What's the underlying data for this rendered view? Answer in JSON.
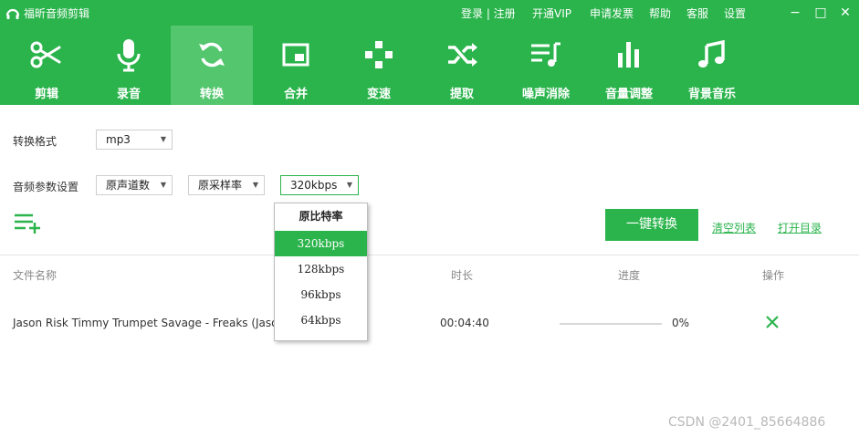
{
  "app": {
    "title": "福昕音频剪辑"
  },
  "top_links": [
    "登录 | 注册",
    "开通VIP",
    "申请发票",
    "帮助",
    "客服",
    "设置"
  ],
  "window_controls": {
    "minimize": "−",
    "maximize": "□",
    "close": "✕"
  },
  "toolbar": {
    "active": "转换",
    "items": [
      {
        "label": "剪辑",
        "icon": "scissors-icon"
      },
      {
        "label": "录音",
        "icon": "microphone-icon"
      },
      {
        "label": "转换",
        "icon": "convert-icon"
      },
      {
        "label": "合并",
        "icon": "merge-icon"
      },
      {
        "label": "变速",
        "icon": "speed-icon"
      },
      {
        "label": "提取",
        "icon": "extract-icon"
      },
      {
        "label": "噪声消除",
        "icon": "noise-reduction-icon"
      },
      {
        "label": "音量调整",
        "icon": "volume-bars-icon"
      },
      {
        "label": "背景音乐",
        "icon": "music-note-icon"
      }
    ]
  },
  "format": {
    "label": "转换格式",
    "value": "mp3"
  },
  "audio_params": {
    "label": "音频参数设置",
    "channel": "原声道数",
    "sample_rate": "原采样率",
    "bitrate": "320kbps"
  },
  "bitrate_dropdown": {
    "options": [
      "原比特率",
      "320kbps",
      "128kbps",
      "96kbps",
      "64kbps"
    ],
    "selected": "320kbps"
  },
  "actions": {
    "convert": "一键转换",
    "clear_list": "清空列表",
    "open_dir": "打开目录"
  },
  "table": {
    "headers": {
      "name": "文件名称",
      "duration": "时长",
      "progress": "进度",
      "action": "操作"
    },
    "rows": [
      {
        "name": "Jason Risk Timmy Trumpet Savage - Freaks (Jaso",
        "duration": "00:04:40",
        "progress_text": "0%",
        "progress": 0
      }
    ]
  },
  "watermark": "CSDN @2401_85664886",
  "colors": {
    "brand_green": "#2bb44c",
    "active_tab": "#53c66e"
  }
}
